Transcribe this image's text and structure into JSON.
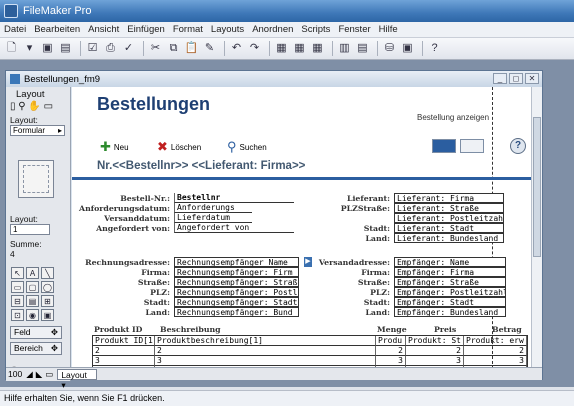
{
  "app": {
    "title": "FileMaker Pro"
  },
  "menu": [
    "Datei",
    "Bearbeiten",
    "Ansicht",
    "Einfügen",
    "Format",
    "Layouts",
    "Anordnen",
    "Scripts",
    "Fenster",
    "Hilfe"
  ],
  "document": {
    "title": "Bestellungen_fm9"
  },
  "status_area": {
    "layout_label": "Layout",
    "layout_sub_label": "Layout:",
    "layout_value": "Formular",
    "layout_count_label": "Layout:",
    "layout_count_value": "1",
    "sum_label": "Summe:",
    "sum_value": "4",
    "field_button": "Feld",
    "part_button": "Bereich",
    "zoom": "100",
    "mode": "Layout"
  },
  "form": {
    "title": "Bestellungen",
    "show_order": "Bestellung anzeigen",
    "actions": {
      "new": "Neu",
      "delete": "Löschen",
      "search": "Suchen"
    },
    "help": "?",
    "order_heading": "Nr.<<Bestellnr>>  <<Lieferant: Firma>>",
    "left_fields": [
      {
        "label": "Bestell-Nr.:",
        "value": "Bestellnr"
      },
      {
        "label": "Anforderungsdatum:",
        "value": "Anforderungs"
      },
      {
        "label": "Versanddatum:",
        "value": "Lieferdatum"
      },
      {
        "label": "Angefordert von:",
        "value": "Angefordert von"
      }
    ],
    "right_fields": [
      {
        "label": "Lieferant:",
        "value": "Lieferant: Firma"
      },
      {
        "label": "PLZStraße:",
        "value": "Lieferant: Straße"
      },
      {
        "label": "",
        "value": "Lieferant: Postleitzahl"
      },
      {
        "label": "Stadt:",
        "value": "Lieferant: Stadt"
      },
      {
        "label": "Land:",
        "value": "Lieferant: Bundesland"
      }
    ],
    "billing_fields": [
      {
        "label": "Rechnungsadresse:",
        "value": "Rechnungsempfänger Name"
      },
      {
        "label": "Firma:",
        "value": "Rechnungsempfänger: Firm"
      },
      {
        "label": "Straße:",
        "value": "Rechnungsempfänger: Straß"
      },
      {
        "label": "PLZ:",
        "value": "Rechnungsempfänger: Postl"
      },
      {
        "label": "Stadt:",
        "value": "Rechnungsempfänger: Stadt"
      },
      {
        "label": "Land:",
        "value": "Rechnungsempfänger: Bund"
      }
    ],
    "shipping_fields": [
      {
        "label": "Versandadresse:",
        "value": "Empfänger: Name"
      },
      {
        "label": "Firma:",
        "value": "Empfänger: Firma"
      },
      {
        "label": "Straße:",
        "value": "Empfänger: Straße"
      },
      {
        "label": "PLZ:",
        "value": "Empfänger: Postleitzahl"
      },
      {
        "label": "Stadt:",
        "value": "Empfänger: Stadt"
      },
      {
        "label": "Land:",
        "value": "Empfänger: Bundesland"
      }
    ],
    "portal_headers": {
      "product_id": "Produkt ID",
      "description": "Beschreibung",
      "qty": "Menge",
      "price": "Preis",
      "amount": "Betrag"
    },
    "portal_rows": [
      [
        "Produkt ID[1",
        "Produktbeschreibung[1]",
        "Produ",
        "Produkt: St",
        "Produkt: erw"
      ],
      [
        "2",
        "2",
        "2",
        "2",
        "2"
      ],
      [
        "3",
        "3",
        "3",
        "3",
        "3"
      ],
      [
        "4",
        "4",
        "4",
        "4",
        "4"
      ]
    ]
  },
  "status_bar": "Hilfe erhalten Sie, wenn Sie F1 drücken."
}
